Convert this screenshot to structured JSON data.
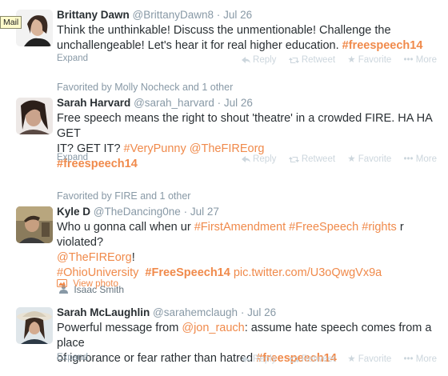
{
  "tooltip": "Mail",
  "tweets": [
    {
      "name": "Brittany Dawn",
      "handle": "@BrittanyDawn8",
      "time": "Jul 26",
      "text": [
        "Think the unthinkable! Discuss the unmentionable! Challenge the",
        "unchallengeable! Let's hear it for real higher education."
      ],
      "tag": "#freespeech14",
      "expand": "Expand"
    },
    {
      "context": "Favorited by Molly Nocheck and 1 other",
      "name": "Sarah Harvard",
      "handle": "@sarah_harvard",
      "time": "Jul 26",
      "text1": "Free speech means the right to shout 'theatre' in a crowded FIRE. HA HA GET",
      "text2": "IT? GET IT?",
      "tag1": "#VeryPunny",
      "mention": "@TheFIREorg",
      "tag2": "#freespeech14",
      "expand": "Expand"
    },
    {
      "context": "Favorited by FIRE and 1 other",
      "name": "Kyle D",
      "handle": "@TheDancing0ne",
      "time": "Jul 27",
      "pre": "Who u gonna call when ur",
      "tags": [
        "#FirstAmendment",
        "#FreeSpeech",
        "#rights"
      ],
      "post": "r violated?",
      "mention": "@TheFIREorg",
      "bang": "!",
      "tag_a": "#OhioUniversity",
      "tag_b": "#FreeSpeech14",
      "link": "pic.twitter.com/U3oQwgVx9a",
      "tagged_user": "Isaac Smith",
      "view_photo": "View photo"
    },
    {
      "name": "Sarah McLaughlin",
      "handle": "@sarahemclaugh",
      "time": "Jul 26",
      "pre": "Powerful message from",
      "mention": "@jon_rauch",
      "post": ": assume hate speech comes from a place",
      "line2": "of ignorance or fear rather than hatred",
      "tag": "#freespeech14",
      "expand": "Expand"
    }
  ],
  "actions": {
    "reply": "Reply",
    "retweet": "Retweet",
    "favorite": "Favorite",
    "more": "More"
  },
  "sep": "·"
}
